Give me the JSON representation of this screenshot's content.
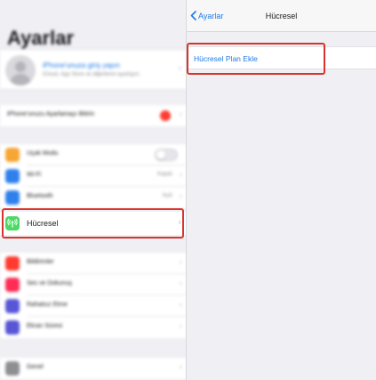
{
  "settings": {
    "title": "Ayarlar",
    "profile": {
      "name_line": "iPhone'unuza giriş yapın",
      "sub_line": "iCloud, App Store ve diğerlerini ayarlayın."
    },
    "suggestion": {
      "label": "iPhone'unuzu Ayarlamayı Bitirin"
    },
    "rows_group1": [
      {
        "label": "Uçak Modu",
        "value": "",
        "icon": "airplane-icon",
        "color": "#f7a534"
      },
      {
        "label": "Wi-Fi",
        "value": "Kapalı",
        "icon": "wifi-icon",
        "color": "#2f80ed"
      },
      {
        "label": "Bluetooth",
        "value": "Açık",
        "icon": "bluetooth-icon",
        "color": "#2f80ed"
      }
    ],
    "cellular": {
      "label": "Hücresel",
      "icon": "cellular-antenna-icon",
      "color": "#4cd964"
    },
    "rows_group2": [
      {
        "label": "Bildirimler",
        "icon": "notifications-icon",
        "color": "#ff3b30"
      },
      {
        "label": "Ses ve Dokunuş",
        "icon": "sounds-icon",
        "color": "#ff2d55"
      },
      {
        "label": "Rahatsız Etme",
        "icon": "moon-icon",
        "color": "#5856d6"
      },
      {
        "label": "Ekran Süresi",
        "icon": "hourglass-icon",
        "color": "#5856d6"
      }
    ],
    "rows_group3": [
      {
        "label": "Genel",
        "icon": "gear-icon",
        "color": "#8e8e93"
      }
    ]
  },
  "detail": {
    "back_label": "Ayarlar",
    "title": "Hücresel",
    "add_plan_label": "Hücresel Plan Ekle"
  },
  "colors": {
    "accent": "#1e7be6",
    "highlight": "#d9342b",
    "background": "#efeff4"
  }
}
